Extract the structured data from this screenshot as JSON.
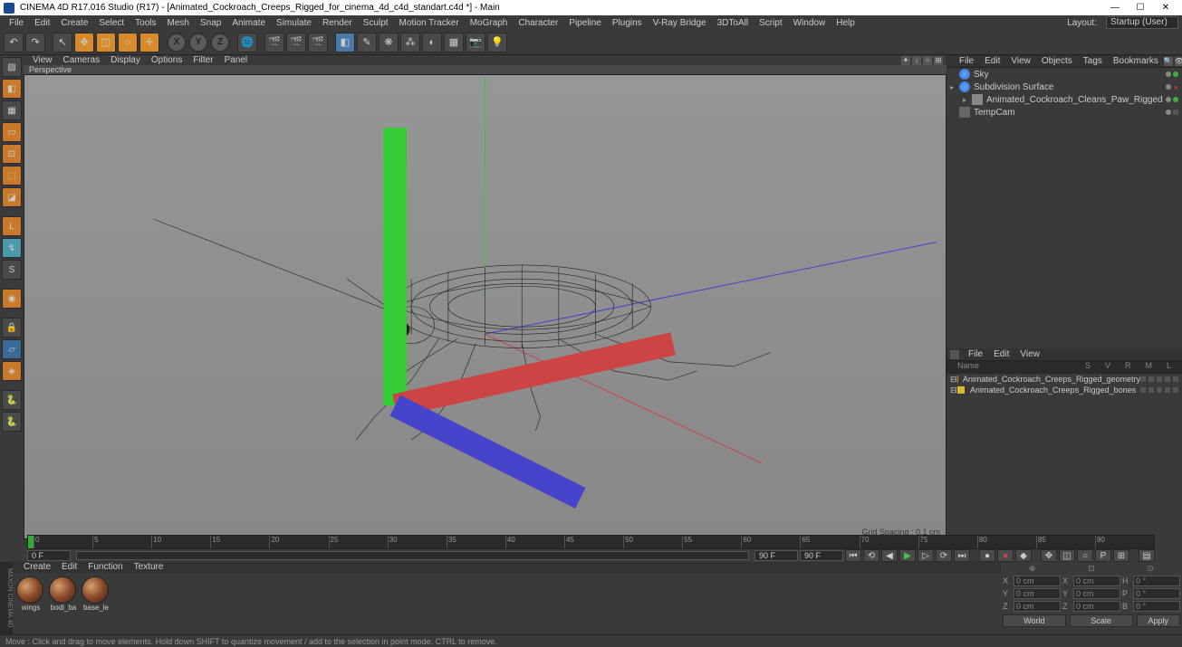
{
  "titlebar": {
    "text": "CINEMA 4D R17.016 Studio (R17) - [Animated_Cockroach_Creeps_Rigged_for_cinema_4d_c4d_standart.c4d *] - Main"
  },
  "main_menu": {
    "items": [
      "File",
      "Edit",
      "Create",
      "Select",
      "Tools",
      "Mesh",
      "Snap",
      "Animate",
      "Simulate",
      "Render",
      "Sculpt",
      "Motion Tracker",
      "MoGraph",
      "Character",
      "Pipeline",
      "Plugins",
      "V-Ray Bridge",
      "3DToAll",
      "Script",
      "Window",
      "Help"
    ],
    "layout_label": "Layout:",
    "layout_value": "Startup (User)"
  },
  "viewport_menu": {
    "items": [
      "View",
      "Cameras",
      "Display",
      "Options",
      "Filter",
      "Panel"
    ]
  },
  "viewport": {
    "label": "Perspective",
    "grid_spacing": "Grid Spacing : 0.1 cm"
  },
  "objects_panel": {
    "menu": [
      "File",
      "Edit",
      "View",
      "Objects",
      "Tags",
      "Bookmarks"
    ],
    "tree": [
      {
        "name": "Sky",
        "icon": "sky",
        "indent": 0
      },
      {
        "name": "Subdivision Surface",
        "icon": "subdiv",
        "indent": 0,
        "expand": "+"
      },
      {
        "name": "Animated_Cockroach_Cleans_Paw_Rigged",
        "icon": "null",
        "indent": 1,
        "expand": "+"
      },
      {
        "name": "TempCam",
        "icon": "cam",
        "indent": 0
      }
    ]
  },
  "attributes_panel": {
    "menu": [
      "File",
      "Edit",
      "View"
    ],
    "header": [
      "Name",
      "S",
      "V",
      "R",
      "M",
      "L"
    ],
    "takes": [
      {
        "name": "Animated_Cockroach_Creeps_Rigged_geometry",
        "color": "or"
      },
      {
        "name": "Animated_Cockroach_Creeps_Rigged_bones",
        "color": "ye"
      }
    ]
  },
  "timeline": {
    "ticks": [
      "0",
      "5",
      "10",
      "15",
      "20",
      "25",
      "30",
      "35",
      "40",
      "45",
      "50",
      "55",
      "60",
      "65",
      "70",
      "75",
      "80",
      "85",
      "90"
    ],
    "start_frame": "0 F",
    "current_frame": "90 F",
    "end_frame": "90 F"
  },
  "materials_panel": {
    "menu": [
      "Create",
      "Edit",
      "Function",
      "Texture"
    ],
    "materials": [
      {
        "name": "wings"
      },
      {
        "name": "bodi_ba"
      },
      {
        "name": "base_le"
      }
    ]
  },
  "coords": {
    "headers": [
      "",
      "",
      ""
    ],
    "rows": [
      {
        "axis": "X",
        "pos": "0 cm",
        "size_axis": "X",
        "size": "0 cm",
        "rot_axis": "H",
        "rot": "0 °"
      },
      {
        "axis": "Y",
        "pos": "0 cm",
        "size_axis": "Y",
        "size": "0 cm",
        "rot_axis": "P",
        "rot": "0 °"
      },
      {
        "axis": "Z",
        "pos": "0 cm",
        "size_axis": "Z",
        "size": "0 cm",
        "rot_axis": "B",
        "rot": "0 °"
      }
    ],
    "world": "World",
    "scale": "Scale",
    "apply": "Apply"
  },
  "status": "Move : Click and drag to move elements. Hold down SHIFT to quantize movement / add to the selection in point mode. CTRL to remove."
}
